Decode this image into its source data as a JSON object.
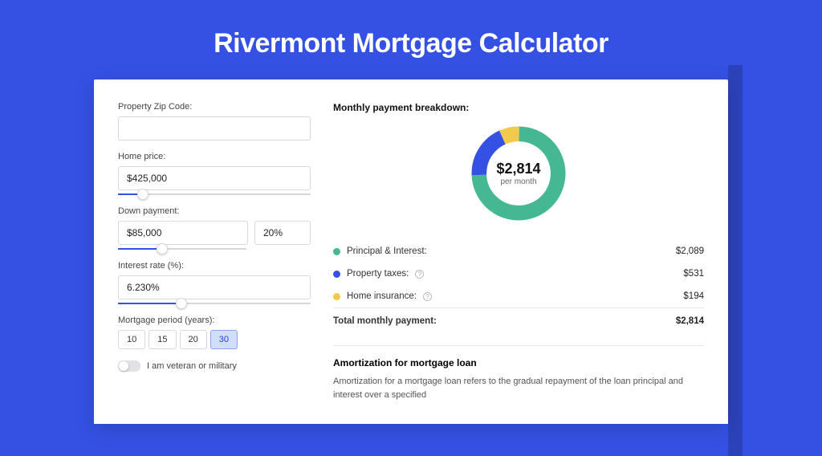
{
  "page_title": "Rivermont Mortgage Calculator",
  "form": {
    "zip_label": "Property Zip Code:",
    "zip_value": "",
    "price_label": "Home price:",
    "price_value": "$425,000",
    "down_label": "Down payment:",
    "down_value": "$85,000",
    "down_pct": "20%",
    "rate_label": "Interest rate (%):",
    "rate_value": "6.230%",
    "period_label": "Mortgage period (years):",
    "periods": [
      "10",
      "15",
      "20",
      "30"
    ],
    "period_selected": "30",
    "veteran_label": "I am veteran or military"
  },
  "breakdown": {
    "title": "Monthly payment breakdown:",
    "amount": "$2,814",
    "per": "per month",
    "items": [
      {
        "label": "Principal & Interest:",
        "value": "$2,089",
        "color": "g"
      },
      {
        "label": "Property taxes:",
        "value": "$531",
        "color": "b",
        "info": true
      },
      {
        "label": "Home insurance:",
        "value": "$194",
        "color": "y",
        "info": true
      }
    ],
    "total_label": "Total monthly payment:",
    "total_value": "$2,814"
  },
  "amortization": {
    "title": "Amortization for mortgage loan",
    "text": "Amortization for a mortgage loan refers to the gradual repayment of the loan principal and interest over a specified"
  },
  "chart_data": {
    "type": "pie",
    "title": "Monthly payment breakdown",
    "series": [
      {
        "name": "Principal & Interest",
        "value": 2089,
        "color": "#45b893"
      },
      {
        "name": "Property taxes",
        "value": 531,
        "color": "#3551e3"
      },
      {
        "name": "Home insurance",
        "value": 194,
        "color": "#f1c94b"
      }
    ],
    "total": 2814,
    "unit": "USD per month"
  }
}
